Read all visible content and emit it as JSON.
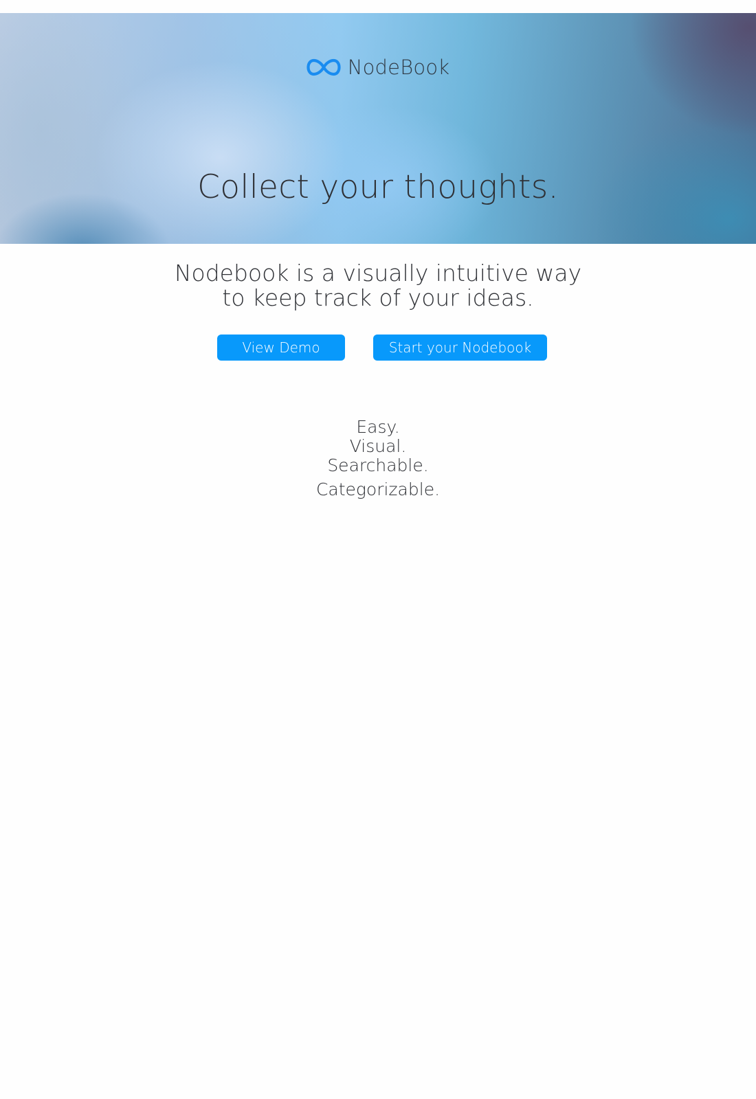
{
  "brand": {
    "name": "NodeBook",
    "logo_icon": "infinity-icon",
    "logo_color": "#1a8cf0"
  },
  "hero": {
    "title": "Collect your thoughts."
  },
  "intro": {
    "line1": "Nodebook is a visually intuitive way",
    "line2": "to keep track of your ideas."
  },
  "actions": {
    "view_demo_label": "View Demo",
    "start_label": "Start your Nodebook",
    "button_color": "#0899fb"
  },
  "features": [
    "Easy.",
    "Visual.",
    "Searchable.",
    "Categorizable."
  ]
}
